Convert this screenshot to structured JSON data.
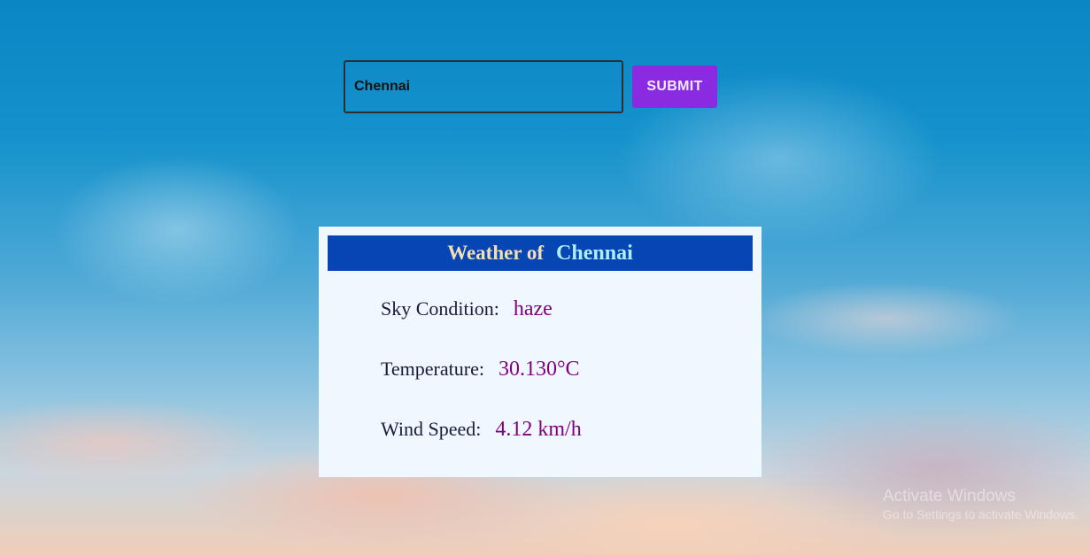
{
  "search": {
    "value": "Chennai",
    "submit_label": "SUBMIT"
  },
  "card": {
    "header_prefix": "Weather of",
    "city": "Chennai",
    "sky": {
      "label": "Sky Condition:",
      "value": "haze"
    },
    "temperature": {
      "label": "Temperature:",
      "value": "30.130°C"
    },
    "wind": {
      "label": "Wind Speed:",
      "value": "4.12 km/h"
    }
  },
  "watermark": {
    "title": "Activate Windows",
    "subtitle": "Go to Settings to activate Windows."
  },
  "colors": {
    "submit_button": "#8a2be2",
    "header_bg": "#0645b4",
    "card_bg": "#f0f8ff",
    "value_text": "#800080"
  }
}
